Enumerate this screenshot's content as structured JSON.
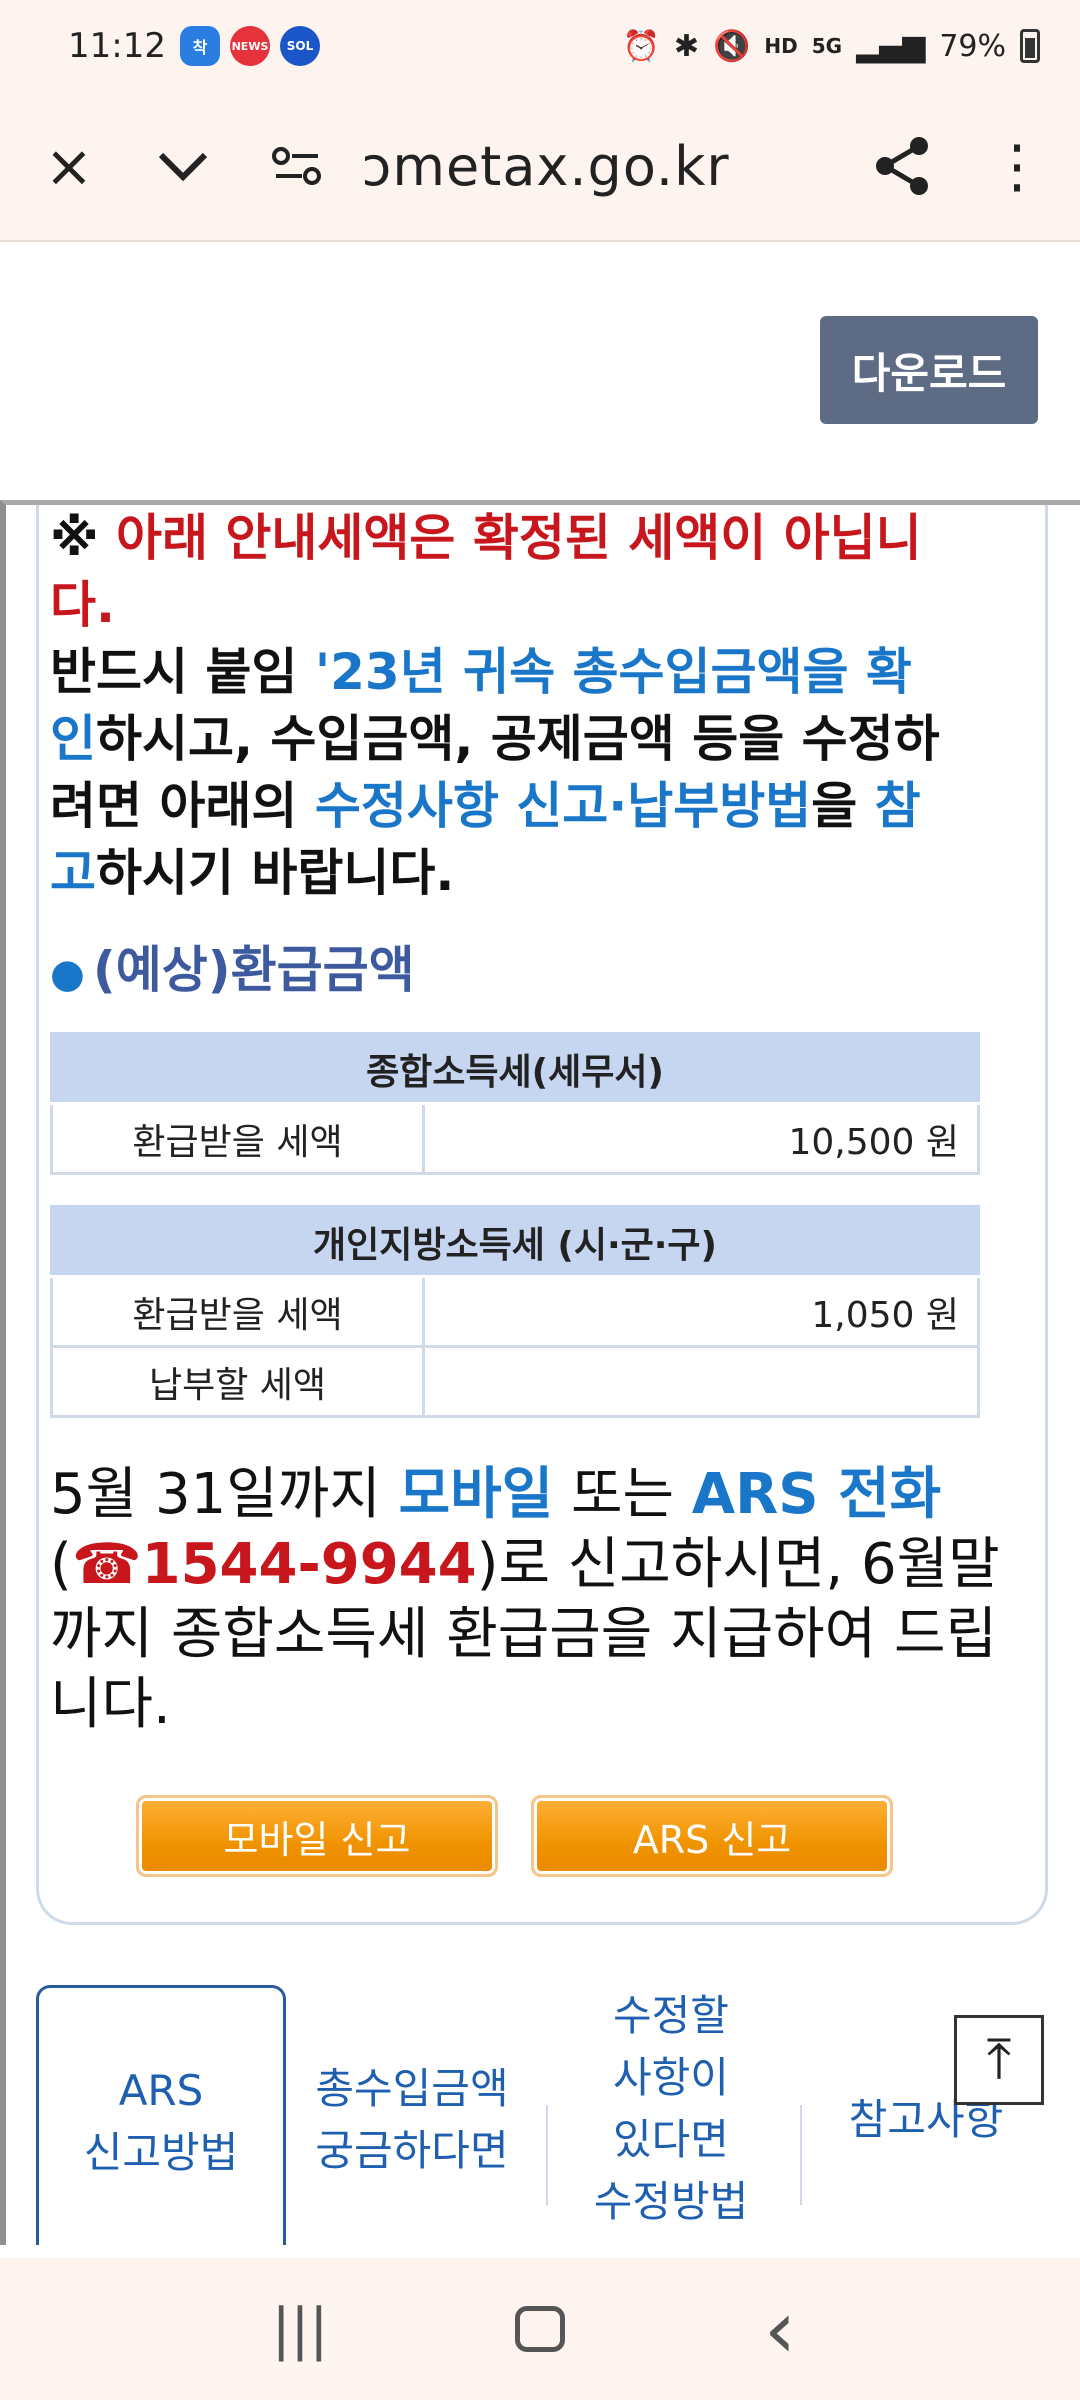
{
  "status_bar": {
    "time": "11:12",
    "badges": [
      {
        "label": "착",
        "color": "#2a7de1"
      },
      {
        "label": "NEWS",
        "color": "#e6333b"
      },
      {
        "label": "SOL",
        "color": "#1b56c9"
      }
    ],
    "network": "HD",
    "network_5g": "5G",
    "battery": "79%"
  },
  "browser": {
    "close_icon": "×",
    "menu_icon": "⌄",
    "site_settings_icon": "⚙",
    "url": "ɔmetax.go.kr",
    "share_icon": "share",
    "more_icon": "⋮"
  },
  "top": {
    "download_label": "다운로드"
  },
  "notice": {
    "line1_prefix": "※ ",
    "line1_red": "아래 안내세액은 확정된 세액이 아닙니다.",
    "line2_a": "반드시 붙임 ",
    "line2_blue": "'23년 귀속 총수입금액을 확인",
    "line2_b": "하시고, 수입금액, 공제금액 등을 수정하려면 아래의 ",
    "line2_blue2": "수정사항 신고·납부방법",
    "line2_c": "을 ",
    "line2_blue3": "참고",
    "line2_d": "하시기 바랍니다."
  },
  "section": {
    "bullet": "●",
    "title": "(예상)환급금액"
  },
  "table1": {
    "header": "종합소득세(세무서)",
    "rows": [
      {
        "label": "환급받을 세액",
        "value": "10,500 원"
      }
    ]
  },
  "table2": {
    "header": "개인지방소득세 (시·군·구)",
    "rows": [
      {
        "label": "환급받을 세액",
        "value": "1,050 원"
      },
      {
        "label": "납부할 세액",
        "value": ""
      }
    ]
  },
  "info": {
    "a": "5월 31일까지 ",
    "mobile": "모바일",
    "b": " 또는 ",
    "ars": "ARS 전화",
    "c": "(",
    "phone_icon": "☎",
    "phone": "1544-9944",
    "d": ")로 신고하시면, 6월말까지 종합소득세 환급금을 지급하여 드립니다."
  },
  "buttons": {
    "mobile_report": "모바일 신고",
    "ars_report": "ARS 신고"
  },
  "tabs": [
    {
      "line1": "ARS",
      "line2": "신고방법"
    },
    {
      "line1": "총수입금액",
      "line2": "궁금하다면"
    },
    {
      "line1": "수정할",
      "line2": "사항이",
      "line3": "있다면",
      "line4": "수정방법"
    },
    {
      "line1": "참고사항"
    }
  ],
  "to_top_icon": "⤒",
  "nav": {
    "recents": "|||",
    "back": "‹"
  }
}
